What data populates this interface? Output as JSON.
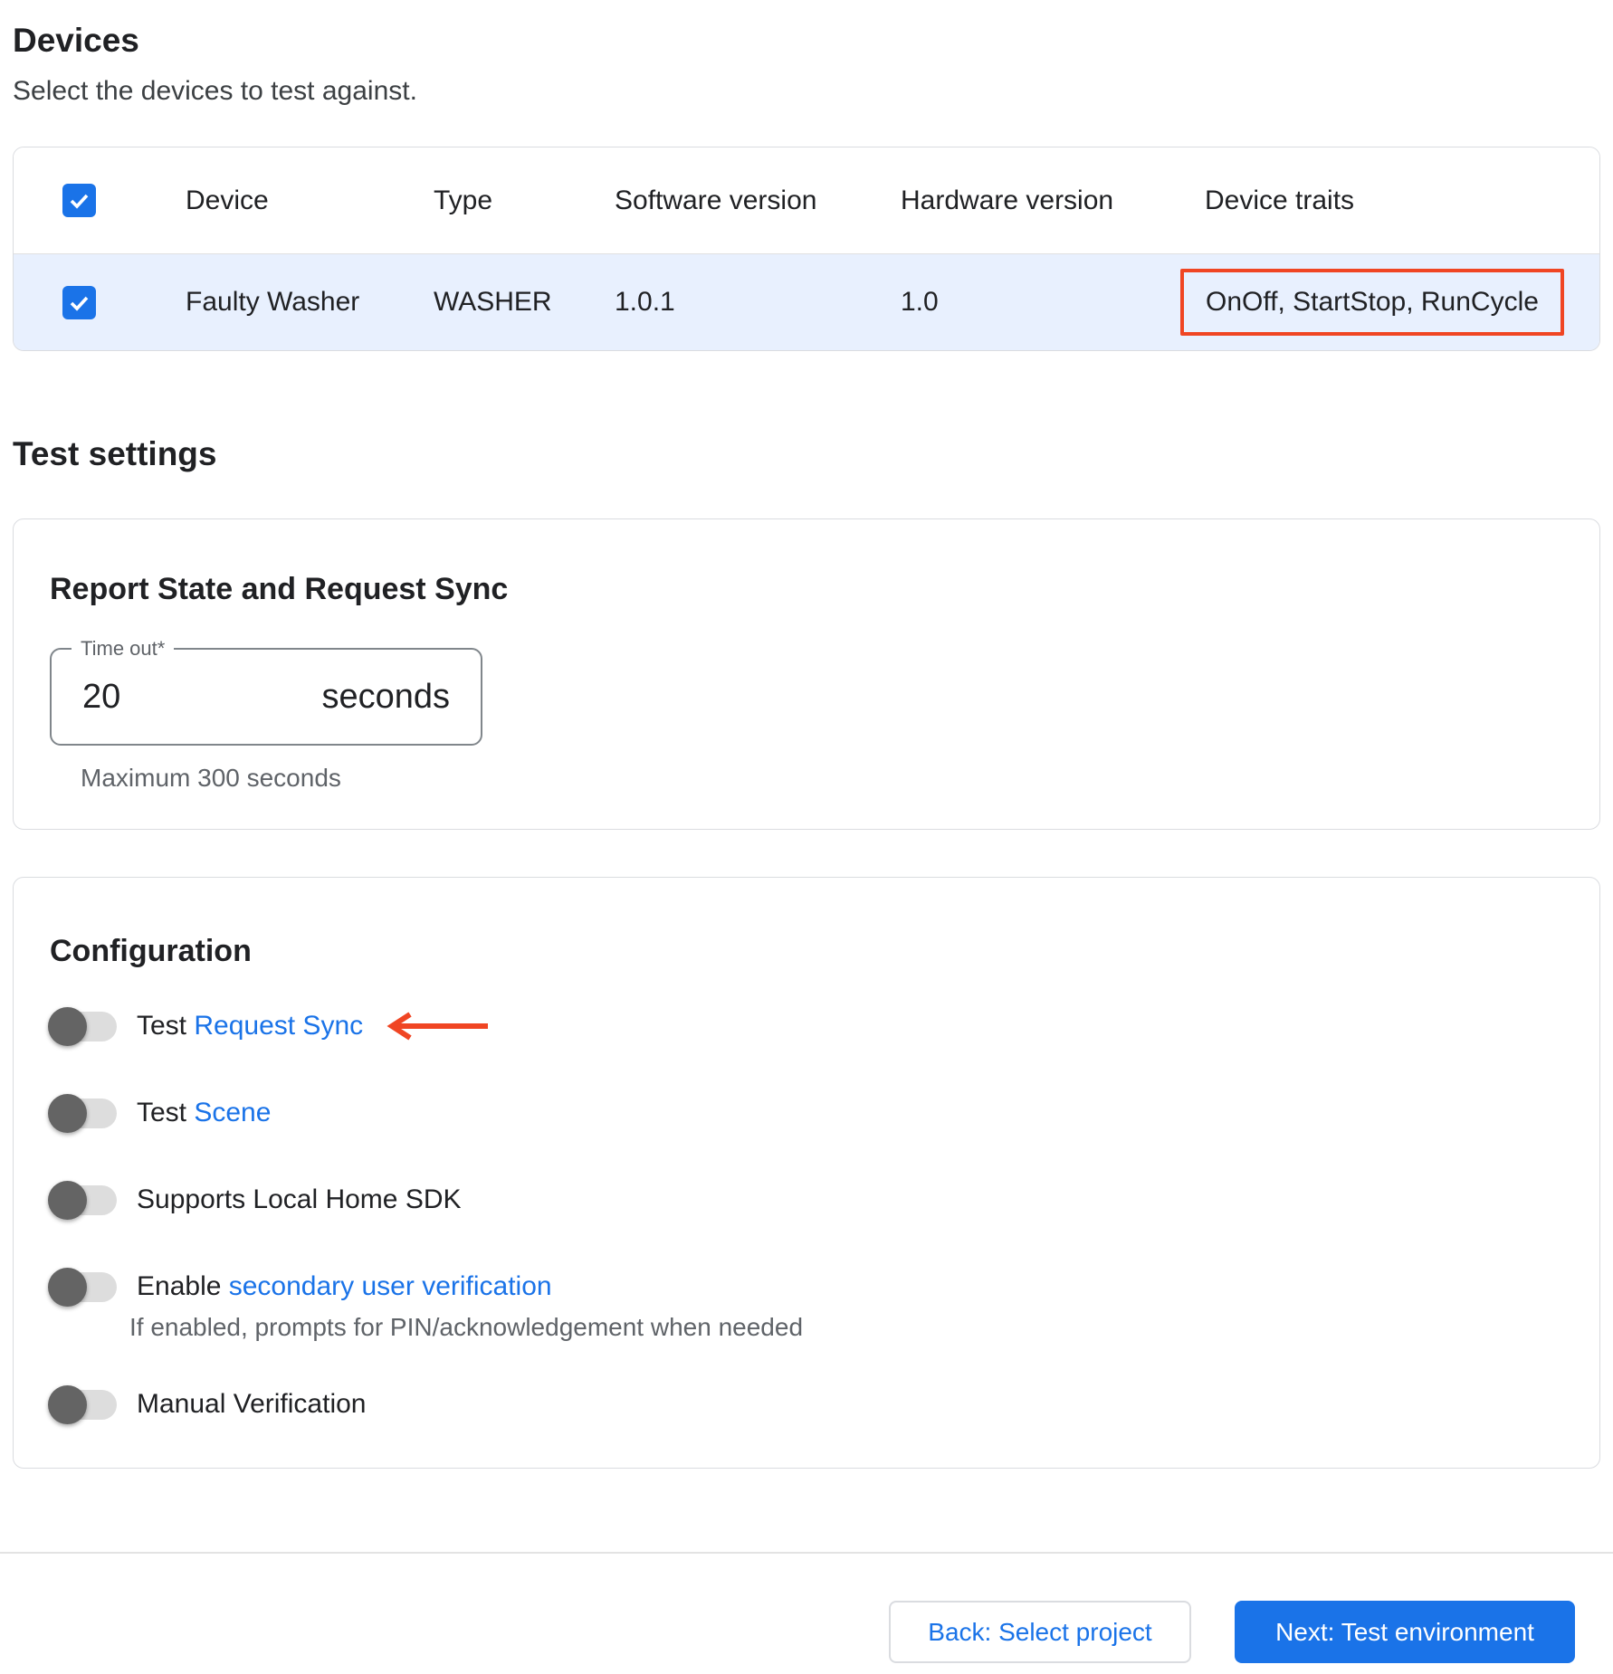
{
  "devices": {
    "title": "Devices",
    "subtitle": "Select the devices to test against.",
    "table": {
      "columns": {
        "device": "Device",
        "type": "Type",
        "software": "Software version",
        "hardware": "Hardware version",
        "traits": "Device traits"
      },
      "row": {
        "device": "Faulty Washer",
        "type": "WASHER",
        "software": "1.0.1",
        "hardware": "1.0",
        "traits": "OnOff, StartStop, RunCycle",
        "selected": true
      },
      "select_all_checked": true
    }
  },
  "test_settings": {
    "title": "Test settings",
    "report_card": {
      "title": "Report State and Request Sync",
      "field_label": "Time out*",
      "value": "20",
      "unit": "seconds",
      "helper": "Maximum 300 seconds"
    },
    "config_card": {
      "title": "Configuration",
      "toggles": [
        {
          "prefix": "Test ",
          "link": "Request Sync",
          "state": "off"
        },
        {
          "prefix": "Test ",
          "link": "Scene",
          "state": "off"
        },
        {
          "prefix": "Supports Local Home SDK",
          "link": "",
          "state": "off"
        },
        {
          "prefix": "Enable ",
          "link": "secondary user verification",
          "state": "off",
          "helper": "If enabled, prompts for PIN/acknowledgement when needed"
        },
        {
          "prefix": "Manual Verification",
          "link": "",
          "state": "off"
        }
      ]
    }
  },
  "footer": {
    "back": "Back: Select project",
    "next": "Next: Test environment"
  },
  "colors": {
    "accent": "#1a73e8",
    "annotation_red": "#f04523",
    "selected_row_bg": "#e8f0fe"
  }
}
